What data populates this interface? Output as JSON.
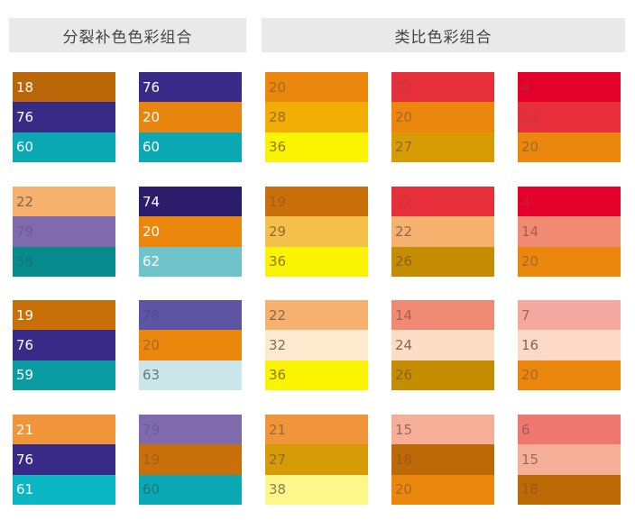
{
  "headers": {
    "left": "分裂补色色彩组合",
    "right": "类比色彩组合"
  },
  "palettes": [
    {
      "group": "left",
      "col": 0,
      "row": 0,
      "swatches": [
        {
          "value": "18",
          "color": "#b96709",
          "text": "#ffffff"
        },
        {
          "value": "76",
          "color": "#3a2a87",
          "text": "#ffffff"
        },
        {
          "value": "60",
          "color": "#0aa9b4",
          "text": "#ffffff"
        }
      ]
    },
    {
      "group": "left",
      "col": 1,
      "row": 0,
      "swatches": [
        {
          "value": "76",
          "color": "#3a2a87",
          "text": "#ffffff"
        },
        {
          "value": "20",
          "color": "#e9850c",
          "text": "#ffffff"
        },
        {
          "value": "60",
          "color": "#0aa9b4",
          "text": "#ffffff"
        }
      ]
    },
    {
      "group": "right",
      "col": 0,
      "row": 0,
      "swatches": [
        {
          "value": "20",
          "color": "#ea870c",
          "text": "#a36a2a"
        },
        {
          "value": "28",
          "color": "#f2ad05",
          "text": "#9a6e20"
        },
        {
          "value": "36",
          "color": "#fbf400",
          "text": "#8b7a2a"
        }
      ]
    },
    {
      "group": "right",
      "col": 1,
      "row": 0,
      "swatches": [
        {
          "value": "12",
          "color": "#e62f3b",
          "text": "#c43a40"
        },
        {
          "value": "20",
          "color": "#ea870c",
          "text": "#a36a2a"
        },
        {
          "value": "27",
          "color": "#d79b06",
          "text": "#8f6a1c"
        }
      ]
    },
    {
      "group": "right",
      "col": 2,
      "row": 0,
      "swatches": [
        {
          "value": "4",
          "color": "#e3002b",
          "text": "#c22038"
        },
        {
          "value": "12",
          "color": "#e62f3b",
          "text": "#c43a40"
        },
        {
          "value": "20",
          "color": "#ea870c",
          "text": "#a36a2a"
        }
      ]
    },
    {
      "group": "left",
      "col": 0,
      "row": 1,
      "swatches": [
        {
          "value": "22",
          "color": "#f6b16e",
          "text": "#7c6a58"
        },
        {
          "value": "79",
          "color": "#7e6aad",
          "text": "#6b5c94"
        },
        {
          "value": "58",
          "color": "#078a8c",
          "text": "#157577"
        }
      ]
    },
    {
      "group": "left",
      "col": 1,
      "row": 1,
      "swatches": [
        {
          "value": "74",
          "color": "#2c1c6c",
          "text": "#ffffff"
        },
        {
          "value": "20",
          "color": "#ea870c",
          "text": "#ffffff"
        },
        {
          "value": "62",
          "color": "#6fc4cc",
          "text": "#ffffff"
        }
      ]
    },
    {
      "group": "right",
      "col": 0,
      "row": 1,
      "swatches": [
        {
          "value": "19",
          "color": "#c9700a",
          "text": "#9e5f20"
        },
        {
          "value": "29",
          "color": "#f5c04a",
          "text": "#8f7030"
        },
        {
          "value": "36",
          "color": "#fbf400",
          "text": "#8b7a2a"
        }
      ]
    },
    {
      "group": "right",
      "col": 1,
      "row": 1,
      "swatches": [
        {
          "value": "12",
          "color": "#e62f3b",
          "text": "#c43a40"
        },
        {
          "value": "22",
          "color": "#f6b16e",
          "text": "#8a6a4a"
        },
        {
          "value": "26",
          "color": "#c48d02",
          "text": "#8a6418"
        }
      ]
    },
    {
      "group": "right",
      "col": 2,
      "row": 1,
      "swatches": [
        {
          "value": "4",
          "color": "#e3002b",
          "text": "#c22038"
        },
        {
          "value": "14",
          "color": "#f18a72",
          "text": "#a5604f"
        },
        {
          "value": "20",
          "color": "#ea870c",
          "text": "#a36a2a"
        }
      ]
    },
    {
      "group": "left",
      "col": 0,
      "row": 2,
      "swatches": [
        {
          "value": "19",
          "color": "#c96f08",
          "text": "#ffffff"
        },
        {
          "value": "76",
          "color": "#3a2a87",
          "text": "#ffffff"
        },
        {
          "value": "59",
          "color": "#0a9ca2",
          "text": "#ffffff"
        }
      ]
    },
    {
      "group": "left",
      "col": 1,
      "row": 2,
      "swatches": [
        {
          "value": "78",
          "color": "#5e54a4",
          "text": "#554a94"
        },
        {
          "value": "20",
          "color": "#ea870c",
          "text": "#a36a2a"
        },
        {
          "value": "63",
          "color": "#cbe6ea",
          "text": "#6a7a7c"
        }
      ]
    },
    {
      "group": "right",
      "col": 0,
      "row": 2,
      "swatches": [
        {
          "value": "22",
          "color": "#f6b16e",
          "text": "#8a6a4a"
        },
        {
          "value": "32",
          "color": "#fde9cd",
          "text": "#7a7060"
        },
        {
          "value": "36",
          "color": "#fbf400",
          "text": "#8b7a2a"
        }
      ]
    },
    {
      "group": "right",
      "col": 1,
      "row": 2,
      "swatches": [
        {
          "value": "14",
          "color": "#f18a72",
          "text": "#a5604f"
        },
        {
          "value": "24",
          "color": "#fcdcc4",
          "text": "#7a6a5c"
        },
        {
          "value": "26",
          "color": "#c48d02",
          "text": "#8a6418"
        }
      ]
    },
    {
      "group": "right",
      "col": 2,
      "row": 2,
      "swatches": [
        {
          "value": "7",
          "color": "#f4a89e",
          "text": "#9a6a62"
        },
        {
          "value": "16",
          "color": "#fcd9c6",
          "text": "#7a6a5c"
        },
        {
          "value": "20",
          "color": "#ea870c",
          "text": "#a36a2a"
        }
      ]
    },
    {
      "group": "left",
      "col": 0,
      "row": 3,
      "swatches": [
        {
          "value": "21",
          "color": "#f0953a",
          "text": "#ffffff"
        },
        {
          "value": "76",
          "color": "#3a2a87",
          "text": "#ffffff"
        },
        {
          "value": "61",
          "color": "#0ab6c2",
          "text": "#ffffff"
        }
      ]
    },
    {
      "group": "left",
      "col": 1,
      "row": 3,
      "swatches": [
        {
          "value": "79",
          "color": "#7e6aad",
          "text": "#6b5c94"
        },
        {
          "value": "19",
          "color": "#c9700a",
          "text": "#9e5f20"
        },
        {
          "value": "60",
          "color": "#0aa9b4",
          "text": "#157a82"
        }
      ]
    },
    {
      "group": "right",
      "col": 0,
      "row": 3,
      "swatches": [
        {
          "value": "21",
          "color": "#f0953a",
          "text": "#9a6a3a"
        },
        {
          "value": "27",
          "color": "#d79b06",
          "text": "#8f6a1c"
        },
        {
          "value": "38",
          "color": "#fdf78a",
          "text": "#8a8050"
        }
      ]
    },
    {
      "group": "right",
      "col": 1,
      "row": 3,
      "swatches": [
        {
          "value": "15",
          "color": "#f5af98",
          "text": "#9a6a5a"
        },
        {
          "value": "18",
          "color": "#bd6a06",
          "text": "#9a5a1c"
        },
        {
          "value": "20",
          "color": "#ea870c",
          "text": "#a36a2a"
        }
      ]
    },
    {
      "group": "right",
      "col": 2,
      "row": 3,
      "swatches": [
        {
          "value": "6",
          "color": "#ee7870",
          "text": "#a55a55"
        },
        {
          "value": "15",
          "color": "#f5af98",
          "text": "#9a6a5a"
        },
        {
          "value": "18",
          "color": "#bd6a06",
          "text": "#9a5a1c"
        }
      ]
    }
  ]
}
